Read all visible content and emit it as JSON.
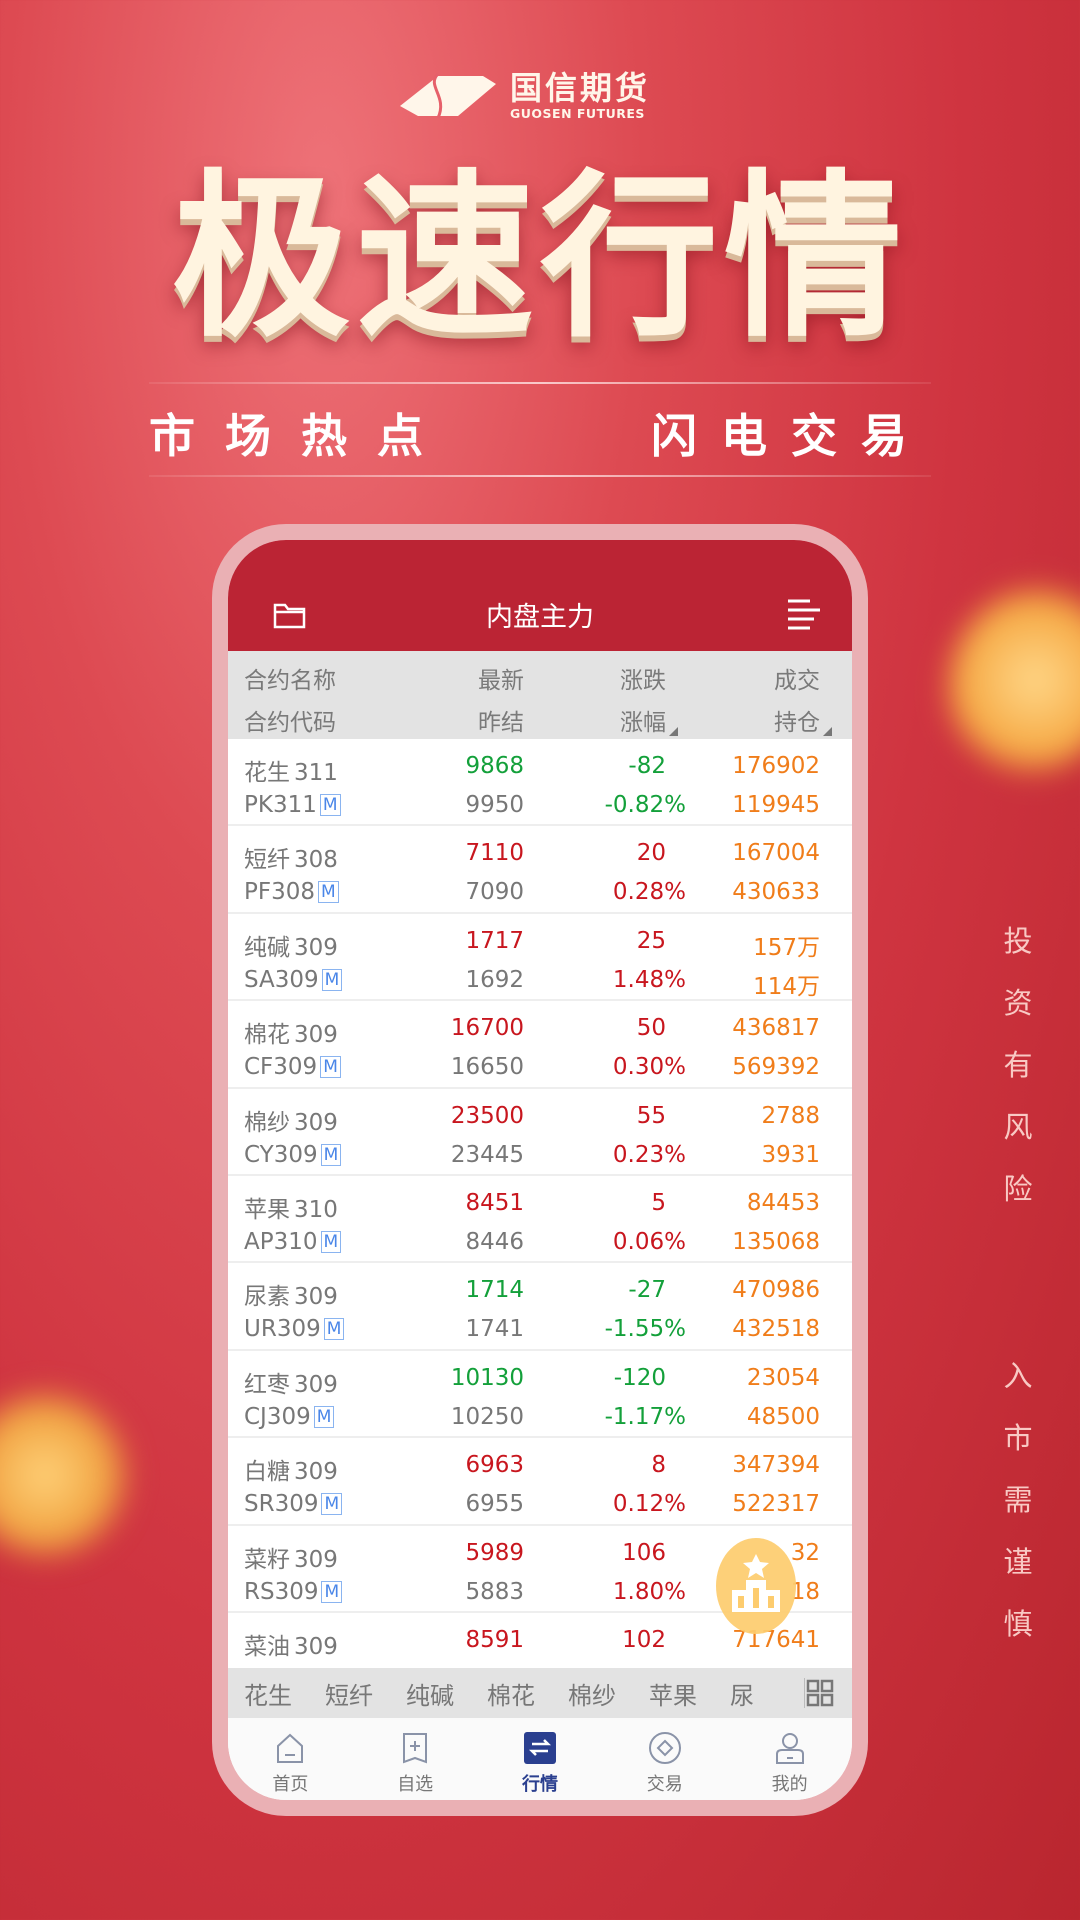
{
  "brand": {
    "name_cn": "国信期货",
    "name_en": "GUOSEN FUTURES"
  },
  "hero": {
    "title": "极速行情",
    "subtitle_left": "市场热点",
    "subtitle_right": "闪电交易"
  },
  "disclaimer": {
    "line1": "投资有风险",
    "line2": "入市需谨慎"
  },
  "app": {
    "header": {
      "title": "内盘主力",
      "left_icon": "folder-icon",
      "right_icon": "menu-icon"
    },
    "columns": {
      "name": "合约名称",
      "code": "合约代码",
      "last": "最新",
      "prev_settle": "昨结",
      "change": "涨跌",
      "change_pct": "涨幅",
      "volume": "成交",
      "open_interest": "持仓"
    },
    "colors": {
      "up": "#c8161e",
      "down": "#13a03a",
      "volume": "#f07d1a",
      "neutral": "#777777",
      "header": "#bb2434"
    },
    "rows": [
      {
        "name": "花生",
        "month": "311",
        "code": "PK311",
        "badge": "M",
        "last": "9868",
        "prev": "9950",
        "chg": "-82",
        "pct": "-0.82%",
        "vol": "176902",
        "oi": "119945",
        "dir": "down"
      },
      {
        "name": "短纤",
        "month": "308",
        "code": "PF308",
        "badge": "M",
        "last": "7110",
        "prev": "7090",
        "chg": "20",
        "pct": "0.28%",
        "vol": "167004",
        "oi": "430633",
        "dir": "up"
      },
      {
        "name": "纯碱",
        "month": "309",
        "code": "SA309",
        "badge": "M",
        "last": "1717",
        "prev": "1692",
        "chg": "25",
        "pct": "1.48%",
        "vol": "157万",
        "oi": "114万",
        "dir": "up"
      },
      {
        "name": "棉花",
        "month": "309",
        "code": "CF309",
        "badge": "M",
        "last": "16700",
        "prev": "16650",
        "chg": "50",
        "pct": "0.30%",
        "vol": "436817",
        "oi": "569392",
        "dir": "up"
      },
      {
        "name": "棉纱",
        "month": "309",
        "code": "CY309",
        "badge": "M",
        "last": "23500",
        "prev": "23445",
        "chg": "55",
        "pct": "0.23%",
        "vol": "2788",
        "oi": "3931",
        "dir": "up"
      },
      {
        "name": "苹果",
        "month": "310",
        "code": "AP310",
        "badge": "M",
        "last": "8451",
        "prev": "8446",
        "chg": "5",
        "pct": "0.06%",
        "vol": "84453",
        "oi": "135068",
        "dir": "up"
      },
      {
        "name": "尿素",
        "month": "309",
        "code": "UR309",
        "badge": "M",
        "last": "1714",
        "prev": "1741",
        "chg": "-27",
        "pct": "-1.55%",
        "vol": "470986",
        "oi": "432518",
        "dir": "down"
      },
      {
        "name": "红枣",
        "month": "309",
        "code": "CJ309",
        "badge": "M",
        "last": "10130",
        "prev": "10250",
        "chg": "-120",
        "pct": "-1.17%",
        "vol": "23054",
        "oi": "48500",
        "dir": "down"
      },
      {
        "name": "白糖",
        "month": "309",
        "code": "SR309",
        "badge": "M",
        "last": "6963",
        "prev": "6955",
        "chg": "8",
        "pct": "0.12%",
        "vol": "347394",
        "oi": "522317",
        "dir": "up"
      },
      {
        "name": "菜籽",
        "month": "309",
        "code": "RS309",
        "badge": "M",
        "last": "5989",
        "prev": "5883",
        "chg": "106",
        "pct": "1.80%",
        "vol": "32",
        "oi": "18",
        "dir": "up"
      },
      {
        "name": "菜油",
        "month": "309",
        "last": "8591",
        "chg": "102",
        "vol": "717641",
        "dir": "up"
      }
    ],
    "category_tabs": [
      "花生",
      "短纤",
      "纯碱",
      "棉花",
      "棉纱",
      "苹果",
      "尿"
    ],
    "nav": [
      {
        "label": "首页",
        "icon": "home-icon"
      },
      {
        "label": "自选",
        "icon": "watchlist-add-icon"
      },
      {
        "label": "行情",
        "icon": "market-icon",
        "active": true
      },
      {
        "label": "交易",
        "icon": "trade-icon"
      },
      {
        "label": "我的",
        "icon": "profile-icon"
      }
    ]
  }
}
